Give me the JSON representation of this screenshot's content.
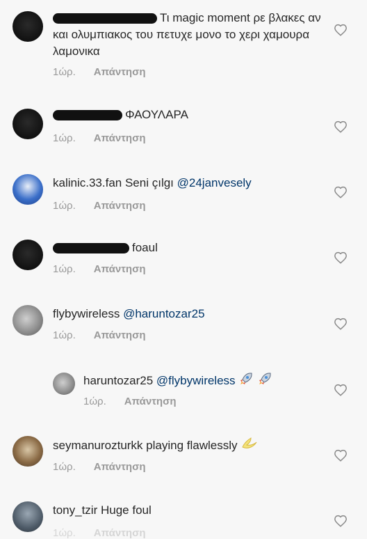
{
  "comments": [
    {
      "username": "",
      "text": "Τι magic moment ρε βλακες αν και ολυμπιακος του πετυχε μονο το χερι χαμουρα λαμονικα",
      "time": "1ώρ.",
      "reply": "Απάντηση",
      "avatar": "redacted-dark-avatar"
    },
    {
      "username": "",
      "text": "ΦΑΟΥΛΑΡΑ",
      "time": "1ώρ.",
      "reply": "Απάντηση",
      "avatar": "redacted-dark-avatar"
    },
    {
      "username": "kalinic.33.fan",
      "text": "Seni çılgı",
      "mention": "@24janvesely",
      "time": "1ώρ.",
      "reply": "Απάντηση",
      "avatar": "blue-avatar"
    },
    {
      "username": "",
      "text": "foaul",
      "time": "1ώρ.",
      "reply": "Απάντηση",
      "avatar": "redacted-dark-avatar"
    },
    {
      "username": "flybywireless",
      "text": "",
      "mention": "@haruntozar25",
      "time": "1ώρ.",
      "reply": "Απάντηση",
      "avatar": "gray-avatar"
    },
    {
      "username": "haruntozar25",
      "text": "",
      "mention": "@flybywireless",
      "emoji": "rocket rocket",
      "time": "1ώρ.",
      "reply": "Απάντηση",
      "avatar": "gray-avatar"
    },
    {
      "username": "seymanurozturkk",
      "text": "playing flawlessly",
      "emoji": "crescent-moon",
      "time": "1ώρ.",
      "reply": "Απάντηση",
      "avatar": "brown-avatar"
    },
    {
      "username": "tony_tzir",
      "text": "Huge foul",
      "time": "1ώρ.",
      "reply": "Απάντηση",
      "avatar": "slate-avatar"
    }
  ],
  "icons": {
    "like": "heart-outline-icon"
  },
  "colors": {
    "mention": "#003569",
    "meta": "#999999",
    "text": "#262626"
  }
}
